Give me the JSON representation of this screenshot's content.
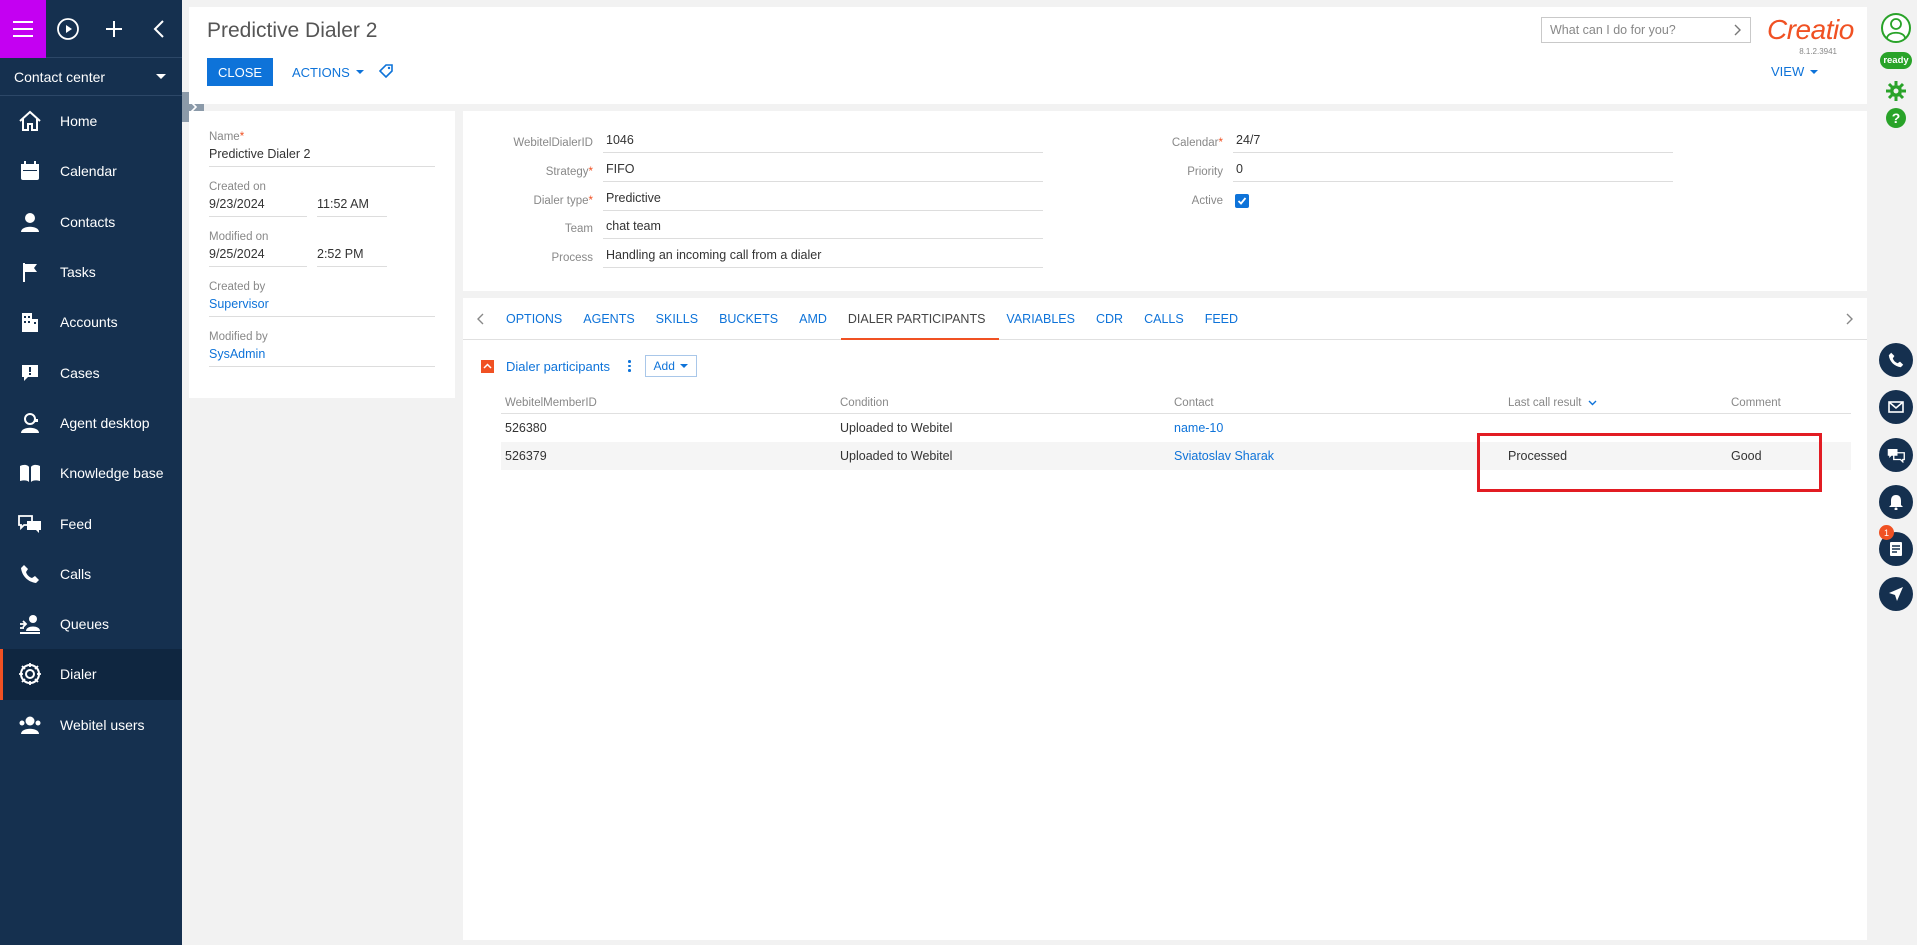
{
  "sidebar": {
    "workplace": "Contact center",
    "items": [
      {
        "label": "Home",
        "icon": "home-icon"
      },
      {
        "label": "Calendar",
        "icon": "calendar-icon"
      },
      {
        "label": "Contacts",
        "icon": "contact-icon"
      },
      {
        "label": "Tasks",
        "icon": "flag-icon"
      },
      {
        "label": "Accounts",
        "icon": "building-icon"
      },
      {
        "label": "Cases",
        "icon": "case-icon"
      },
      {
        "label": "Agent desktop",
        "icon": "agent-icon"
      },
      {
        "label": "Knowledge base",
        "icon": "book-icon"
      },
      {
        "label": "Feed",
        "icon": "chat-icon"
      },
      {
        "label": "Calls",
        "icon": "phone-icon"
      },
      {
        "label": "Queues",
        "icon": "queue-icon"
      },
      {
        "label": "Dialer",
        "icon": "dialer-icon"
      },
      {
        "label": "Webitel users",
        "icon": "users-icon"
      }
    ],
    "active_item": "Dialer",
    "accent_color": "#c400f2",
    "bg_color": "#15304f"
  },
  "header": {
    "title": "Predictive Dialer 2",
    "close_label": "CLOSE",
    "actions_label": "ACTIONS",
    "view_label": "VIEW",
    "search_placeholder": "What can I do for you?",
    "logo_text": "Creatio",
    "version": "8.1.2.3941"
  },
  "info": {
    "name_label": "Name",
    "name_value": "Predictive Dialer 2",
    "created_on_label": "Created on",
    "created_on_date": "9/23/2024",
    "created_on_time": "11:52 AM",
    "modified_on_label": "Modified on",
    "modified_on_date": "9/25/2024",
    "modified_on_time": "2:52 PM",
    "created_by_label": "Created by",
    "created_by_value": "Supervisor",
    "modified_by_label": "Modified by",
    "modified_by_value": "SysAdmin"
  },
  "fields": {
    "webitel_dialer_id_label": "WebitelDialerID",
    "webitel_dialer_id_value": "1046",
    "strategy_label": "Strategy",
    "strategy_value": "FIFO",
    "dialer_type_label": "Dialer type",
    "dialer_type_value": "Predictive",
    "team_label": "Team",
    "team_value": "chat  team",
    "process_label": "Process",
    "process_value": "Handling an incoming call from a dialer",
    "calendar_label": "Calendar",
    "calendar_value": "24/7",
    "priority_label": "Priority",
    "priority_value": "0",
    "active_label": "Active",
    "active_checked": true
  },
  "tabs": [
    "OPTIONS",
    "AGENTS",
    "SKILLS",
    "BUCKETS",
    "AMD",
    "DIALER PARTICIPANTS",
    "VARIABLES",
    "CDR",
    "CALLS",
    "FEED"
  ],
  "active_tab": "DIALER PARTICIPANTS",
  "detail": {
    "title": "Dialer participants",
    "add_label": "Add",
    "columns": [
      "WebitelMemberID",
      "Condition",
      "Contact",
      "Last call result",
      "Comment"
    ],
    "rows": [
      {
        "id": "526380",
        "condition": "Uploaded to Webitel",
        "contact": "name-10",
        "result": "",
        "comment": ""
      },
      {
        "id": "526379",
        "condition": "Uploaded to Webitel",
        "contact": "Sviatoslav Sharak",
        "result": "Processed",
        "comment": "Good"
      }
    ]
  },
  "rightbar": {
    "status_label": "ready",
    "notification_count": "1",
    "status_color": "#29a329"
  }
}
